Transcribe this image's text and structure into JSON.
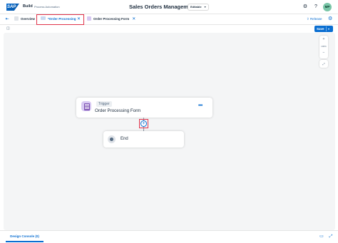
{
  "shell": {
    "logo_text": "SAP",
    "brand": "Build",
    "product": "Process Automation",
    "title": "Sales Orders Management",
    "status": "Editable",
    "avatar_initials": "MP",
    "icons": [
      "settings-icon",
      "help-icon"
    ]
  },
  "tabs": {
    "overview": "Overview",
    "process": "*Order Processing",
    "form": "Order Processing Form",
    "release": "Release"
  },
  "toolbar": {
    "save": "Save"
  },
  "zoom": {
    "value": "100%"
  },
  "canvas": {
    "trigger_chip": "Trigger",
    "trigger_name": "Order Processing Form",
    "end_label": "End"
  },
  "bottom": {
    "console": "Design Console (0)"
  },
  "colors": {
    "accent": "#0a6ed1",
    "highlight": "#e0334b",
    "canvas": "#f4f5f6"
  }
}
